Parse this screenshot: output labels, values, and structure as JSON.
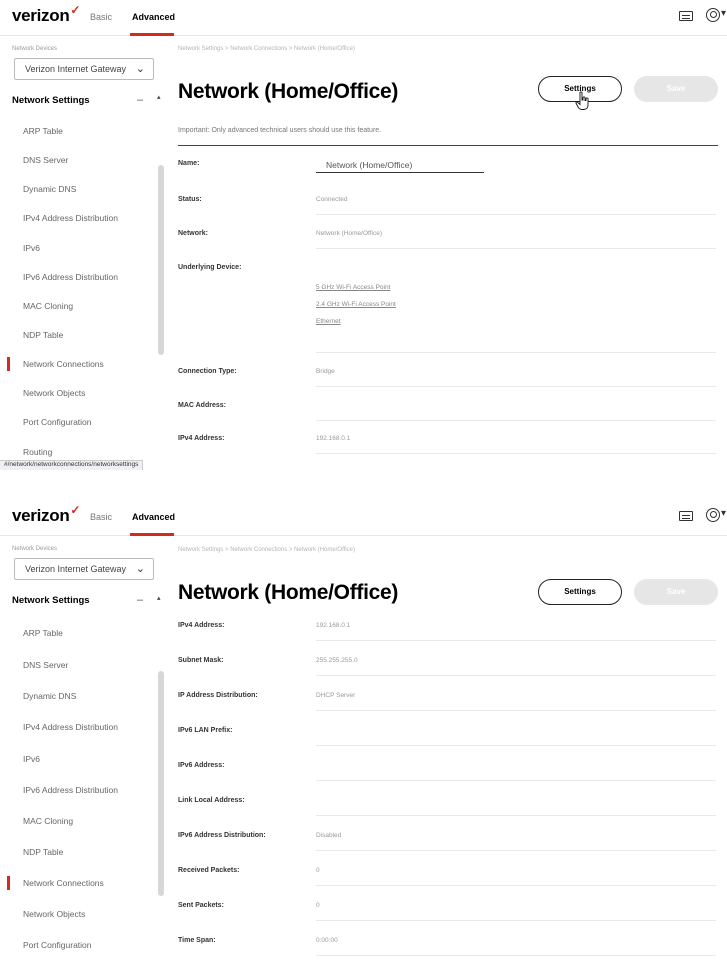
{
  "header": {
    "logo": "verizon",
    "logo_check": "✓",
    "tabs": [
      {
        "label": "Basic",
        "active": false
      },
      {
        "label": "Advanced",
        "active": true
      }
    ],
    "accent_color": "#d52b1e",
    "icons": [
      "keyboard-icon",
      "user-icon"
    ]
  },
  "sidebar": {
    "small_label": "Network Devices",
    "device_select": "Verizon Internet Gateway",
    "group_title": "Network Settings",
    "items": [
      {
        "label": "ARP Table"
      },
      {
        "label": "DNS Server"
      },
      {
        "label": "Dynamic DNS"
      },
      {
        "label": "IPv4 Address Distribution"
      },
      {
        "label": "IPv6"
      },
      {
        "label": "IPv6 Address Distribution"
      },
      {
        "label": "MAC Cloning"
      },
      {
        "label": "NDP Table"
      },
      {
        "label": "Network Connections",
        "active": true
      },
      {
        "label": "Network Objects"
      },
      {
        "label": "Port Configuration"
      },
      {
        "label": "Routing"
      }
    ]
  },
  "status_bar_url": "#/network/networkconnections/networksettings",
  "main": {
    "breadcrumb": "Network Settings  >  Network Connections  >  Network (Home/Office)",
    "title": "Network (Home/Office)",
    "settings_button": "Settings",
    "disabled_button": "Save",
    "note": "Important: Only advanced technical users should use this feature.",
    "name_label": "Name:",
    "name_value": "Network (Home/Office)",
    "rows": {
      "status": {
        "label": "Status:",
        "value": "Connected"
      },
      "network": {
        "label": "Network:",
        "value": "Network (Home/Office)"
      },
      "underlying": {
        "label": "Underlying Device:"
      },
      "connection_type": {
        "label": "Connection Type:",
        "value": "Bridge"
      },
      "mac": {
        "label": "MAC Address:",
        "value": ""
      },
      "ipv4": {
        "label": "IPv4 Address:",
        "value": "192.168.0.1"
      },
      "subnet": {
        "label": "Subnet Mask:",
        "value": "255.255.255.0"
      },
      "ip_dist": {
        "label": "IP Address Distribution:",
        "value": "DHCP Server"
      },
      "ipv6_prefix": {
        "label": "IPv6 LAN Prefix:",
        "value": ""
      },
      "ipv6_addr": {
        "label": "IPv6 Address:",
        "value": ""
      },
      "link_local": {
        "label": "Link Local Address:",
        "value": ""
      },
      "ipv6_dist": {
        "label": "IPv6 Address Distribution:",
        "value": "Disabled"
      },
      "rx": {
        "label": "Received Packets:",
        "value": "0"
      },
      "tx": {
        "label": "Sent Packets:",
        "value": "0"
      },
      "time_span": {
        "label": "Time Span:",
        "value": "0:00:00"
      }
    },
    "underlying_devices": [
      "5 GHz Wi-Fi Access Point",
      "2.4 GHz Wi-Fi Access Point",
      "Ethernet"
    ]
  }
}
